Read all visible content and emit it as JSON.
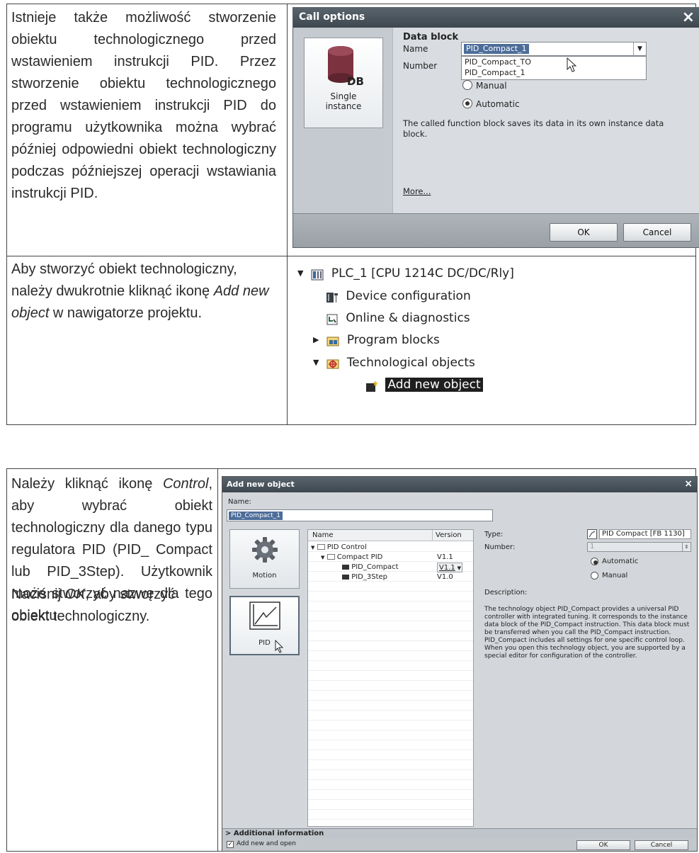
{
  "section1": {
    "paragraph": "Istnieje także możliwość stworzenie obiektu technologicznego przed wstawieniem instrukcji PID. Przez stworzenie obiektu technologicznego przed wstawieniem instrukcji PID do programu użytkownika można wybrać później odpowiedni obiekt technologiczny podczas późniejszej operacji wstawiania instrukcji PID."
  },
  "call_options": {
    "title": "Call options",
    "tile_badge": "DB",
    "tile_label_1": "Single",
    "tile_label_2": "instance",
    "heading": "Data block",
    "name_label": "Name",
    "number_label": "Number",
    "name_value": "PID_Compact_1",
    "dropdown_items": [
      "PID_Compact_TO",
      "PID_Compact_1"
    ],
    "manual_label": "Manual",
    "automatic_label": "Automatic",
    "description": "The called function block saves its data in its own instance data block.",
    "more_link": "More...",
    "ok": "OK",
    "cancel": "Cancel"
  },
  "section2": {
    "text_a": "Aby stworzyć obiekt technologiczny, należy dwukrotnie kliknąć ikonę ",
    "text_em": "Add new object",
    "text_b": " w nawigatorze projektu."
  },
  "tree": {
    "plc": "PLC_1 [CPU 1214C DC/DC/Rly]",
    "device_config": "Device configuration",
    "online_diag": "Online & diagnostics",
    "program_blocks": "Program blocks",
    "tech_objects": "Technological objects",
    "add_new_object": "Add new object"
  },
  "section3": {
    "p1_a": "Należy kliknąć ikonę ",
    "p1_em": "Control",
    "p1_b": ", aby wybrać obiekt technologiczny dla danego typu regulatora PID (PID_ Compact lub PID_3Step). Użytkownik może stworzyć nazwę dla tego obiektu.",
    "p2_a": "Naciśnij ",
    "p2_em": "OK",
    "p2_b": ", aby stworzyć obiekt technologiczny."
  },
  "add_new_object": {
    "title": "Add new object",
    "name_label": "Name:",
    "name_value": "PID_Compact_1",
    "cat_motion": "Motion",
    "cat_pid": "PID",
    "col_name": "Name",
    "col_version": "Version",
    "rows": [
      {
        "name": "PID Control",
        "version": ""
      },
      {
        "name": "Compact PID",
        "version": "V1.1"
      },
      {
        "name": "PID_Compact",
        "version": "V1.1"
      },
      {
        "name": "PID_3Step",
        "version": "V1.0"
      }
    ],
    "type_label": "Type:",
    "type_value": "PID Compact [FB 1130]",
    "number_label": "Number:",
    "number_value": "1",
    "automatic_label": "Automatic",
    "manual_label": "Manual",
    "description_label": "Description:",
    "description": "The technology object PID_Compact provides a universal PID controller with integrated tuning. It corresponds to the instance data block of the PID_Compact instruction. This data block must be transferred when you call the PID_Compact instruction. PID_Compact includes all settings for one specific control loop. When you open this technology object, you are supported by a special editor for configuration of the controller.",
    "additional_info": "Additional information",
    "add_new_and_open": "Add new and open",
    "ok": "OK",
    "cancel": "Cancel"
  }
}
